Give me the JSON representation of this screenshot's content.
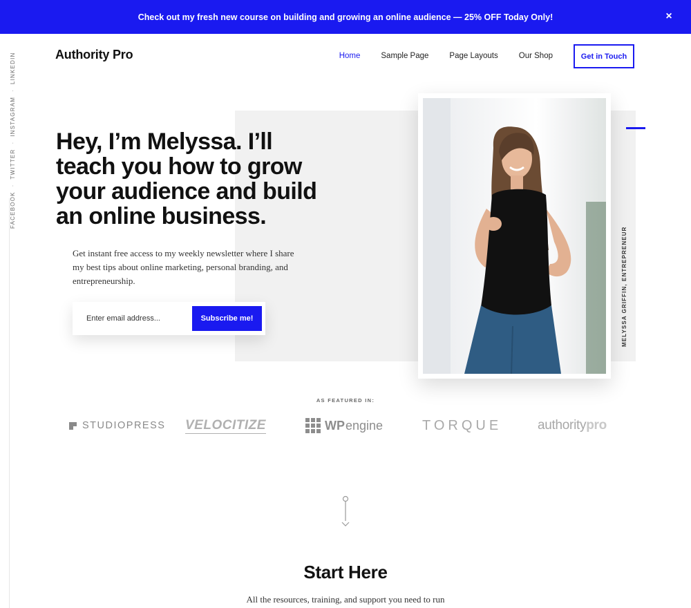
{
  "banner": {
    "text": "Check out my fresh new course on building and growing an online audience — 25% OFF Today Only!",
    "close_glyph": "×"
  },
  "social": {
    "items": [
      "FACEBOOK",
      "TWITTER",
      "INSTAGRAM",
      "LINKEDIN"
    ],
    "separator": "·"
  },
  "header": {
    "logo": "Authority Pro",
    "nav": [
      {
        "label": "Home",
        "active": true
      },
      {
        "label": "Sample Page",
        "active": false
      },
      {
        "label": "Page Layouts",
        "active": false
      },
      {
        "label": "Our Shop",
        "active": false
      }
    ],
    "cta_label": "Get in Touch"
  },
  "hero": {
    "headline": "Hey, I’m Melyssa. I’ll teach you how to grow your audience and build an online business.",
    "intro": "Get instant free access to my weekly newsletter where I share my best tips about online marketing, personal branding, and entrepreneurship.",
    "email_placeholder": "Enter email address...",
    "subscribe_label": "Subscribe me!",
    "photo_caption": "MELYSSA GRIFFIN, ENTREPRENEUR"
  },
  "featured": {
    "label": "AS FEATURED IN:",
    "logos": [
      {
        "text": "STUDIOPRESS",
        "icon": "studiopress-square-icon"
      },
      {
        "text": "VELOCITIZE"
      },
      {
        "bold": "WP",
        "text": "engine",
        "icon": "wpengine-grid-icon"
      },
      {
        "text": "TORQUE"
      },
      {
        "text": "authority",
        "bold": "pro"
      }
    ]
  },
  "start": {
    "title": "Start Here",
    "subtitle": "All the resources, training, and support you need to run"
  },
  "colors": {
    "accent": "#1a1af0",
    "hero_bg": "#f1f1f1",
    "text": "#111111"
  }
}
